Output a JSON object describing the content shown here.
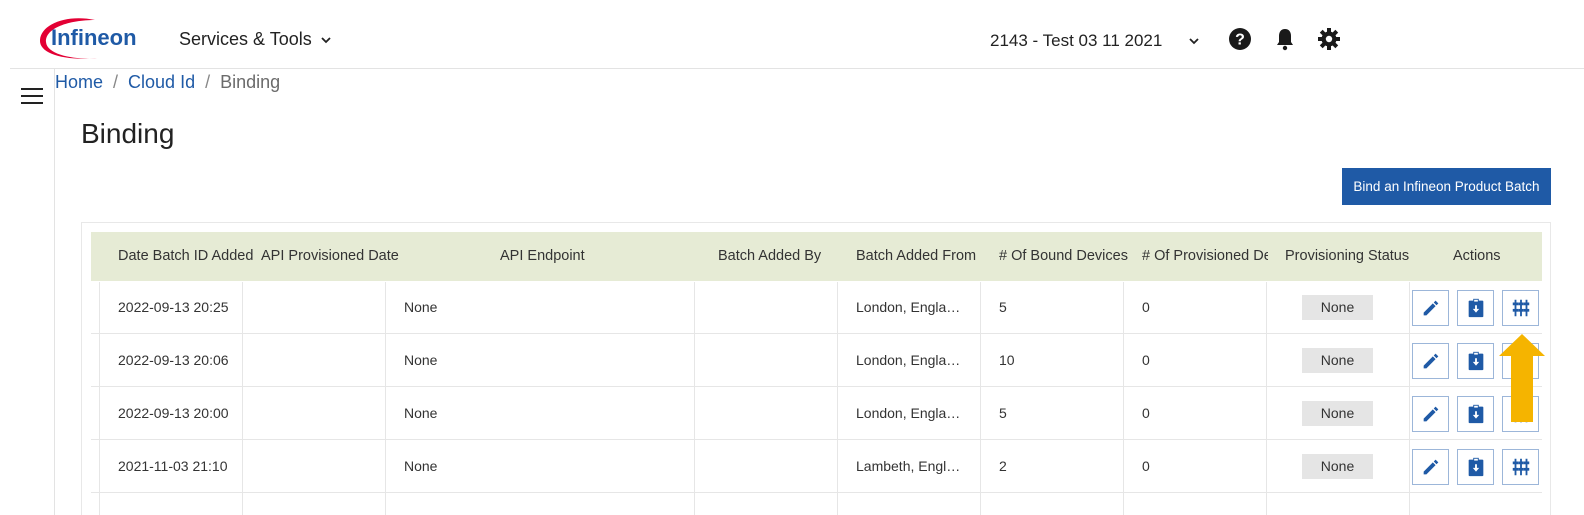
{
  "header": {
    "logo_text": "Infineon",
    "services_label": "Services & Tools",
    "tenant_label": "2143 - Test 03 11 2021",
    "icons": [
      "help-icon",
      "bell-icon",
      "gear-icon"
    ]
  },
  "breadcrumb": {
    "home": "Home",
    "cloud_id": "Cloud Id",
    "current": "Binding",
    "separator": "/"
  },
  "page": {
    "title": "Binding",
    "bind_button": "Bind an Infineon Product Batch"
  },
  "table": {
    "columns": [
      "Date Batch ID Added",
      "API Provisioned Date",
      "API Endpoint",
      "Batch Added By",
      "Batch Added From",
      "# Of Bound Devices",
      "# Of Provisioned Dev",
      "Provisioning Status",
      "Actions"
    ],
    "rows": [
      {
        "date": "2022-09-13 20:25",
        "api_date": "",
        "endpoint": "None",
        "added_by": "",
        "added_from": "London, Engla…",
        "bound": "5",
        "provisioned": "0",
        "status": "None"
      },
      {
        "date": "2022-09-13 20:06",
        "api_date": "",
        "endpoint": "None",
        "added_by": "",
        "added_from": "London, Engla…",
        "bound": "10",
        "provisioned": "0",
        "status": "None"
      },
      {
        "date": "2022-09-13 20:00",
        "api_date": "",
        "endpoint": "None",
        "added_by": "",
        "added_from": "London, Engla…",
        "bound": "5",
        "provisioned": "0",
        "status": "None"
      },
      {
        "date": "2021-11-03 21:10",
        "api_date": "",
        "endpoint": "None",
        "added_by": "",
        "added_from": "Lambeth, Engl…",
        "bound": "2",
        "provisioned": "0",
        "status": "None"
      }
    ]
  },
  "colors": {
    "brand_blue": "#1f5aa6",
    "logo_red": "#e30034",
    "header_bg": "#e6ebd5",
    "arrow": "#f5b400"
  }
}
